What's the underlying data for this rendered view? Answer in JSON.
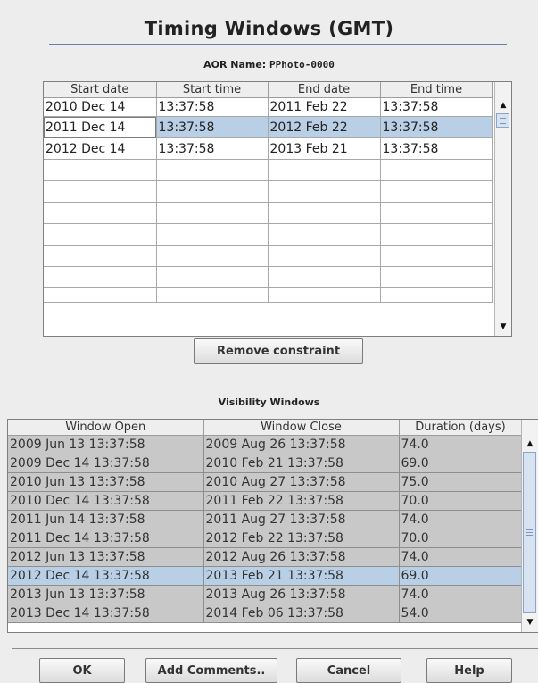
{
  "window": {
    "title": "Timing Windows (GMT)"
  },
  "aor": {
    "label": "AOR Name:",
    "value": "PPhoto-0000"
  },
  "timing_table": {
    "columns": [
      "Start date",
      "Start time",
      "End date",
      "End time"
    ],
    "rows": [
      [
        "2010 Dec 14",
        "13:37:58",
        "2011 Feb 22",
        "13:37:58"
      ],
      [
        "2011 Dec 14",
        "13:37:58",
        "2012 Feb 22",
        "13:37:58"
      ],
      [
        "2012 Dec 14",
        "13:37:58",
        "2013 Feb 21",
        "13:37:58"
      ]
    ],
    "selected_row": 1
  },
  "remove_button": "Remove constraint",
  "visibility": {
    "label": "Visibility Windows",
    "columns": [
      "Window Open",
      "Window Close",
      "Duration (days)"
    ],
    "rows": [
      [
        "2009 Jun 13 13:37:58",
        "2009 Aug 26 13:37:58",
        "74.0"
      ],
      [
        "2009 Dec 14 13:37:58",
        "2010 Feb 21 13:37:58",
        "69.0"
      ],
      [
        "2010 Jun 13 13:37:58",
        "2010 Aug 27 13:37:58",
        "75.0"
      ],
      [
        "2010 Dec 14 13:37:58",
        "2011 Feb 22 13:37:58",
        "70.0"
      ],
      [
        "2011 Jun 14 13:37:58",
        "2011 Aug 27 13:37:58",
        "74.0"
      ],
      [
        "2011 Dec 14 13:37:58",
        "2012 Feb 22 13:37:58",
        "70.0"
      ],
      [
        "2012 Jun 13 13:37:58",
        "2012 Aug 26 13:37:58",
        "74.0"
      ],
      [
        "2012 Dec 14 13:37:58",
        "2013 Feb 21 13:37:58",
        "69.0"
      ],
      [
        "2013 Jun 13 13:37:58",
        "2013 Aug 26 13:37:58",
        "74.0"
      ],
      [
        "2013 Dec 14 13:37:58",
        "2014 Feb 06 13:37:58",
        "54.0"
      ]
    ],
    "selected_row": 7
  },
  "buttons": {
    "ok": "OK",
    "add_comments": "Add Comments..",
    "cancel": "Cancel",
    "help": "Help"
  }
}
